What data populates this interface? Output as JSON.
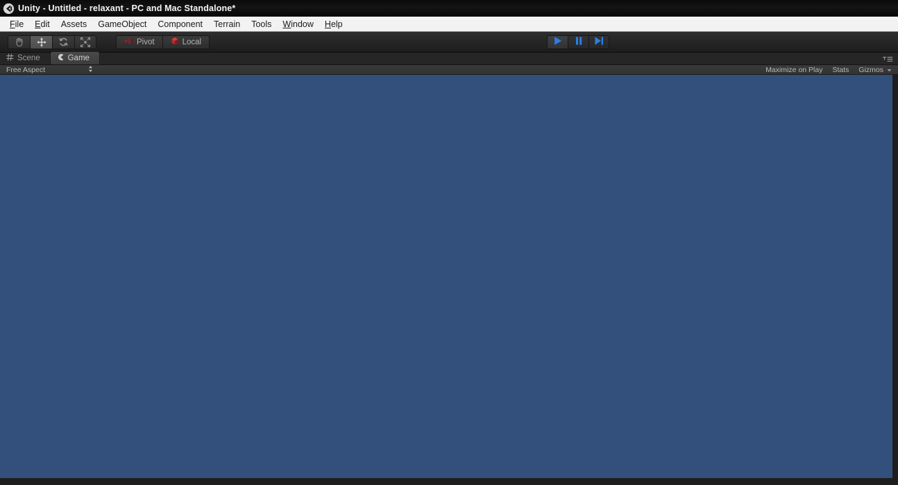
{
  "window": {
    "title": "Unity - Untitled - relaxant - PC and Mac Standalone*",
    "logo_icon": "unity-logo-icon"
  },
  "menubar": {
    "items": [
      {
        "label": "File",
        "mnemonic": "F",
        "rest": "ile"
      },
      {
        "label": "Edit",
        "mnemonic": "E",
        "rest": "dit"
      },
      {
        "label": "Assets",
        "mnemonic": "",
        "rest": "Assets"
      },
      {
        "label": "GameObject",
        "mnemonic": "",
        "rest": "GameObject"
      },
      {
        "label": "Component",
        "mnemonic": "",
        "rest": "Component"
      },
      {
        "label": "Terrain",
        "mnemonic": "",
        "rest": "Terrain"
      },
      {
        "label": "Tools",
        "mnemonic": "",
        "rest": "Tools"
      },
      {
        "label": "Window",
        "mnemonic": "W",
        "rest": "indow"
      },
      {
        "label": "Help",
        "mnemonic": "H",
        "rest": "elp"
      }
    ]
  },
  "toolbar": {
    "transform_tools": [
      {
        "name": "hand-tool",
        "icon": "hand-icon",
        "selected": false
      },
      {
        "name": "move-tool",
        "icon": "move-icon",
        "selected": true
      },
      {
        "name": "rotate-tool",
        "icon": "rotate-icon",
        "selected": false
      },
      {
        "name": "scale-tool",
        "icon": "scale-icon",
        "selected": false
      }
    ],
    "pivot_label": "Pivot",
    "pivot_icon": "pivot-center-icon",
    "local_label": "Local",
    "local_icon": "local-globe-icon",
    "playback": [
      {
        "name": "play-button",
        "icon": "play-icon",
        "active": true
      },
      {
        "name": "pause-button",
        "icon": "pause-icon",
        "active": false
      },
      {
        "name": "step-button",
        "icon": "step-icon",
        "active": false
      }
    ]
  },
  "tabs": [
    {
      "label": "Scene",
      "icon": "scene-grid-icon",
      "active": false
    },
    {
      "label": "Game",
      "icon": "game-pacman-icon",
      "active": true
    }
  ],
  "tab_menu_icon": "tab-options-icon",
  "game_toolbar": {
    "aspect_label": "Free Aspect",
    "aspect_arrows_icon": "updown-arrows-icon",
    "maximize_on_play_label": "Maximize on Play",
    "stats_label": "Stats",
    "gizmos_label": "Gizmos",
    "gizmos_arrow_icon": "chevron-down-icon"
  },
  "game_view": {
    "background_color": "#32507b"
  },
  "colors": {
    "titlebar_bg": "#0d0d0d",
    "menubar_bg": "#f2f2f2",
    "toolbar_bg": "#262626",
    "tabrow_bg": "#262626",
    "tab_active_bg": "#454545",
    "game_toolbar_bg": "#363636",
    "play_accent": "#2a7fe8",
    "pivot_accent": "#9e2b2b",
    "text_light": "#b4b4b4",
    "text_dark": "#1a1a1a"
  }
}
